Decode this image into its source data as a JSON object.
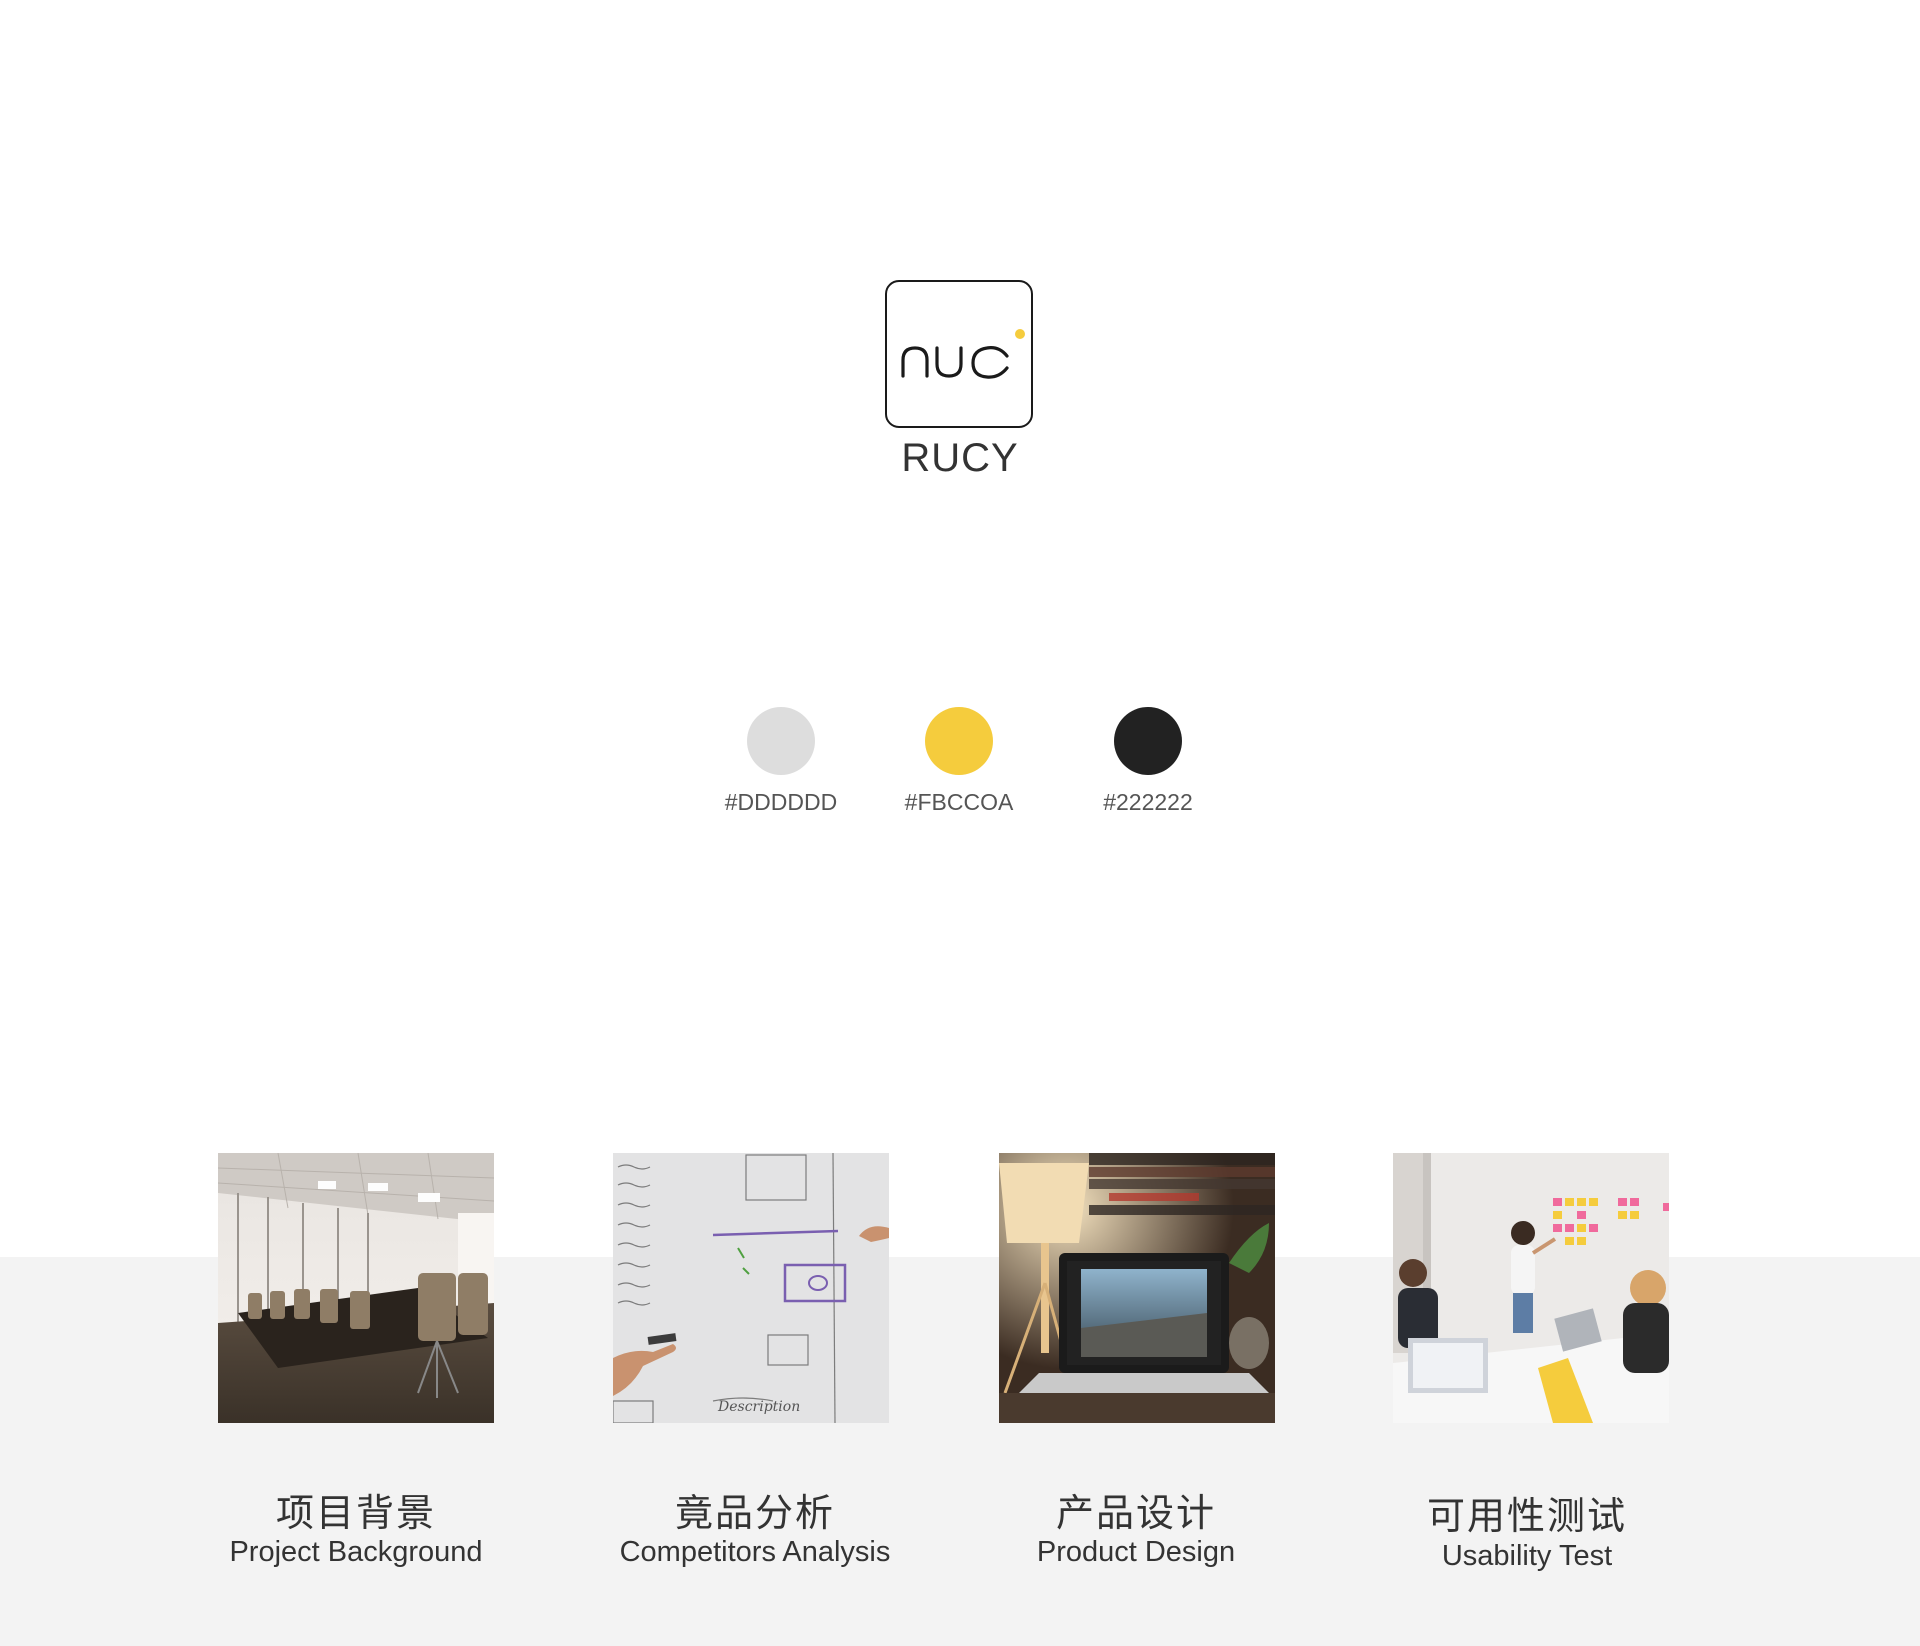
{
  "brand": {
    "logo_mark": "ruc",
    "name": "RUCY"
  },
  "palette": [
    {
      "color": "#DDDDDD",
      "label": "#DDDDDD"
    },
    {
      "color": "#F5CC3D",
      "label": "#FBCCOA"
    },
    {
      "color": "#222222",
      "label": "#222222"
    }
  ],
  "sections": [
    {
      "title_cn": "项目背景",
      "title_en": "Project Background",
      "image": "conference-room-photo"
    },
    {
      "title_cn": "竟品分析",
      "title_en": "Competitors Analysis",
      "image": "whiteboard-sketch-photo"
    },
    {
      "title_cn": "产品设计",
      "title_en": "Product Design",
      "image": "laptop-desk-photo"
    },
    {
      "title_cn": "可用性测试",
      "title_en": "Usability Test",
      "image": "team-meeting-photo"
    }
  ],
  "colors": {
    "background": "#FFFFFF",
    "band": "#F3F3F3",
    "accent": "#F5CC3D",
    "text": "#333333"
  }
}
